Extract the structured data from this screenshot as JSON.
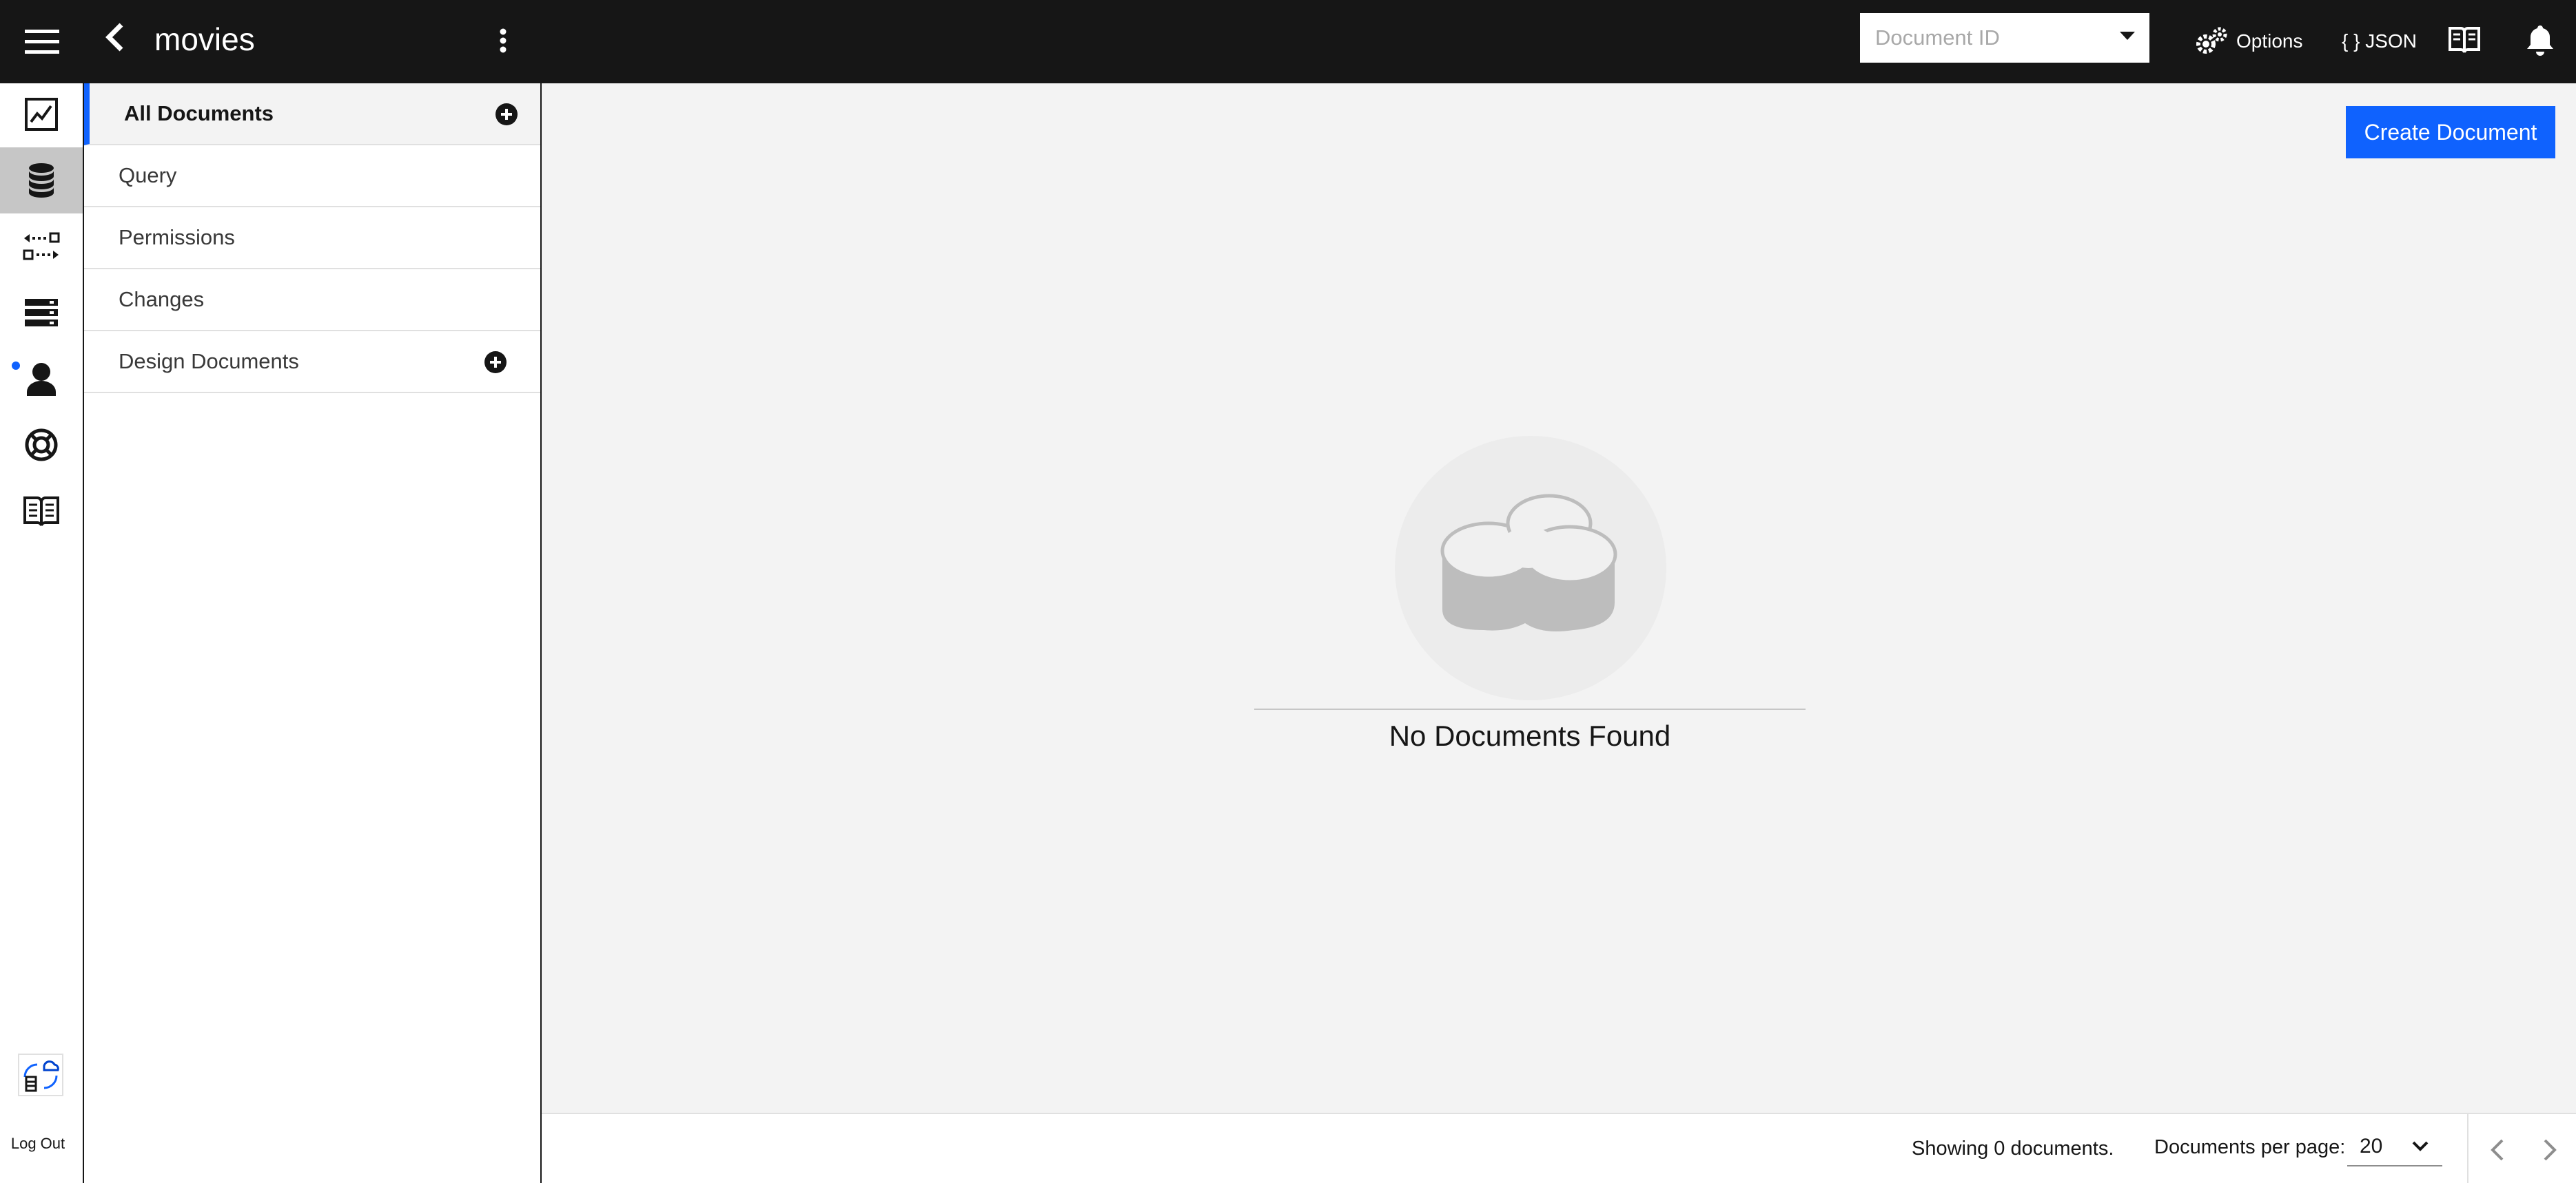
{
  "sidebar": {
    "title": "movies",
    "items": [
      {
        "label": "All Documents"
      },
      {
        "label": "Query"
      },
      {
        "label": "Permissions"
      },
      {
        "label": "Changes"
      },
      {
        "label": "Design Documents"
      }
    ]
  },
  "topbar": {
    "doc_id_placeholder": "Document ID",
    "options_label": "Options",
    "json_label": "{ } JSON"
  },
  "rail": {
    "logout_label": "Log Out",
    "icons": [
      "activity-chart-icon",
      "database-icon",
      "replication-icon",
      "server-stack-icon",
      "user-icon",
      "help-lifebuoy-icon",
      "documentation-book-icon"
    ]
  },
  "main": {
    "create_label": "Create Document",
    "empty_message": "No Documents Found"
  },
  "footer": {
    "showing": "Showing 0 documents.",
    "per_page_label": "Documents per page:",
    "per_page_value": "20"
  },
  "colors": {
    "accent": "#0f62fe",
    "header_bg": "#161616",
    "canvas_bg": "#f3f3f3"
  }
}
